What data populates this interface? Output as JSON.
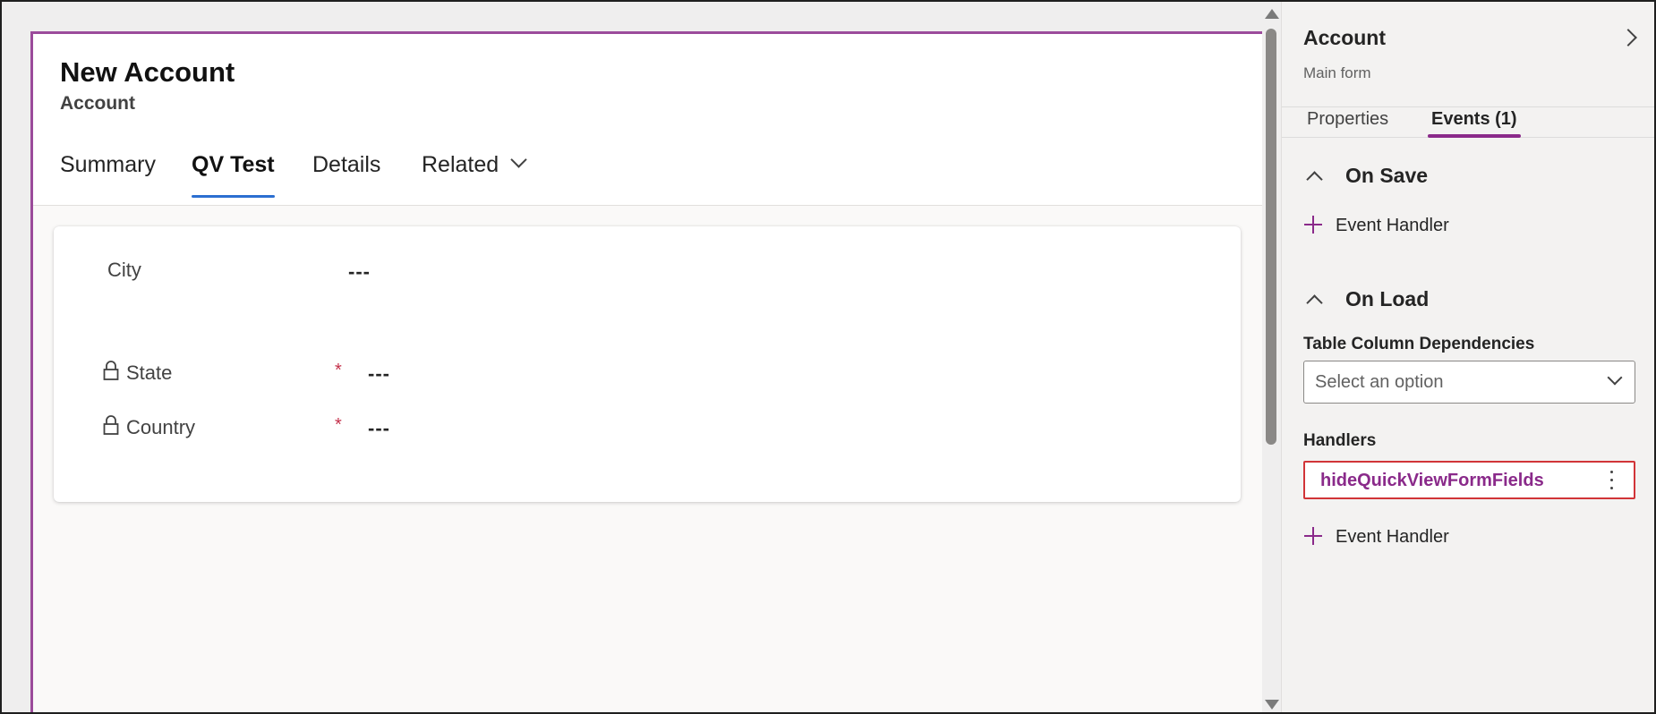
{
  "form": {
    "title": "New Account",
    "subtitle": "Account",
    "tabs": [
      {
        "label": "Summary",
        "active": false
      },
      {
        "label": "QV Test",
        "active": true
      },
      {
        "label": "Details",
        "active": false
      },
      {
        "label": "Related",
        "active": false,
        "has_dropdown": true
      }
    ],
    "fields": [
      {
        "label": "City",
        "value": "---",
        "locked": false,
        "required": false
      },
      {
        "label": "State",
        "value": "---",
        "locked": true,
        "required": true
      },
      {
        "label": "Country",
        "value": "---",
        "locked": true,
        "required": true
      }
    ],
    "required_marker": "*"
  },
  "panel": {
    "title": "Account",
    "subtitle": "Main form",
    "tabs": [
      {
        "label": "Properties",
        "active": false
      },
      {
        "label": "Events (1)",
        "active": true
      }
    ],
    "on_save": {
      "title": "On Save",
      "add_handler_label": "Event Handler"
    },
    "on_load": {
      "title": "On Load",
      "dependencies_label": "Table Column Dependencies",
      "select_placeholder": "Select an option",
      "handlers_label": "Handlers",
      "handlers": [
        "hideQuickViewFormFields"
      ],
      "add_handler_label": "Event Handler"
    }
  },
  "colors": {
    "form_border": "#9b4b9b",
    "tab_underline": "#2b6fd1",
    "accent": "#8a2a8a",
    "error_border": "#d13438",
    "required": "#c4314b"
  }
}
